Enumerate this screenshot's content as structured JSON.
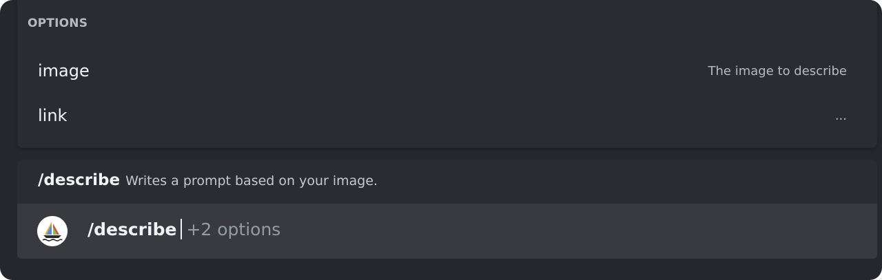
{
  "options": {
    "header": "OPTIONS",
    "items": [
      {
        "name": "image",
        "description": "The image to describe"
      },
      {
        "name": "link",
        "description": "..."
      }
    ]
  },
  "command": {
    "name": "/describe",
    "description": "Writes a prompt based on your image."
  },
  "input": {
    "value": "/describe",
    "hint": "+2 options",
    "avatar_icon": "midjourney-sailboat-icon"
  },
  "colors": {
    "background": "#26272c",
    "panel": "#2b2c31",
    "input_row": "#383a40",
    "text_primary": "#f2f3f5",
    "text_muted": "#b5bac1"
  }
}
